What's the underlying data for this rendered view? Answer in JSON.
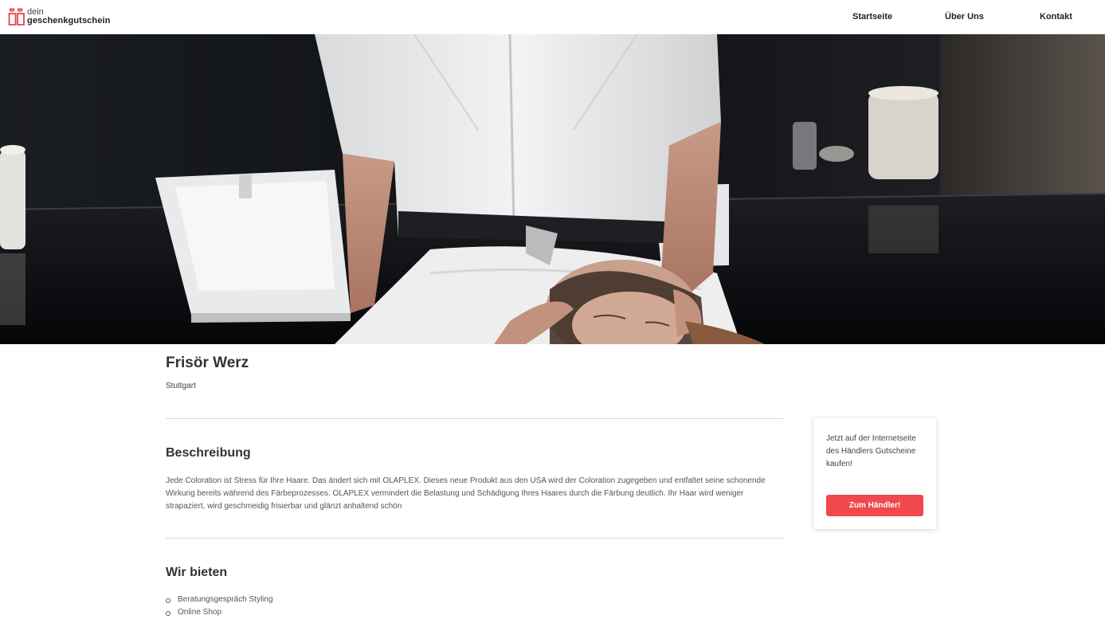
{
  "header": {
    "logo_small": "dein",
    "logo_big": "geschenkgutschein",
    "nav": [
      "Startseite",
      "Über Uns",
      "Kontakt"
    ]
  },
  "merchant": {
    "name": "Frisör Werz",
    "city": "Stuttgart"
  },
  "description": {
    "heading": "Beschreibung",
    "text": "Jede Coloration ist Stress für Ihre Haare. Das ändert sich mit OLAPLEX. Dieses neue Produkt aus den USA wird der Coloration zugegeben und entfaltet seine schonende Wirkung bereits während des Färbeprozesses. OLAPLEX vermindert die Belastung und Schädigung Ihres Haares durch die Färbung deutlich. Ihr Haar wird weniger strapaziert, wird geschmeidig frisierbar und glänzt anhaltend schön"
  },
  "offers": {
    "heading": "Wir bieten",
    "items": [
      "Beratungsgespräch Styling",
      "Online Shop"
    ]
  },
  "card": {
    "text": "Jetzt auf der Internetseite des Händlers Gutscheine kaufen!",
    "button": "Zum Händler!"
  },
  "colors": {
    "accent": "#f0484d",
    "logo": "#e8444b"
  },
  "hero_icon": "spa-photo"
}
